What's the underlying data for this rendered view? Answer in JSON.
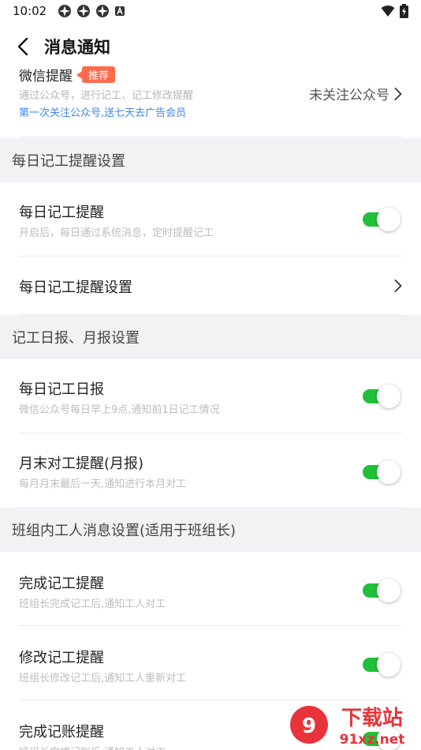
{
  "status_bar": {
    "time": "10:02"
  },
  "nav": {
    "title": "消息通知"
  },
  "wechat": {
    "title": "微信提醒",
    "tag": "推荐",
    "subtitle": "通过公众号，进行记工、记工修改提醒",
    "link": "第一次关注公众号,送七天去广告会员",
    "status": "未关注公众号"
  },
  "sections": [
    {
      "header": "每日记工提醒设置",
      "rows": [
        {
          "title": "每日记工提醒",
          "subtitle": "开启后，每日通过系统消息，定时提醒记工",
          "control": "toggle",
          "on": true
        },
        {
          "title": "每日记工提醒设置",
          "control": "chevron"
        }
      ]
    },
    {
      "header": "记工日报、月报设置",
      "rows": [
        {
          "title": "每日记工日报",
          "subtitle": "微信公众号每日早上9点,通知前1日记工情况",
          "control": "toggle",
          "on": true
        },
        {
          "title": "月末对工提醒(月报)",
          "subtitle": "每月月末最后一天,通知进行本月对工",
          "control": "toggle",
          "on": true
        }
      ]
    },
    {
      "header": "班组内工人消息设置(适用于班组长)",
      "rows": [
        {
          "title": "完成记工提醒",
          "subtitle": "班组长完成记工后,通知工人对工",
          "control": "toggle",
          "on": true
        },
        {
          "title": "修改记工提醒",
          "subtitle": "班组长修改记工后,通知工人重新对工",
          "control": "toggle",
          "on": true
        },
        {
          "title": "完成记账提醒",
          "subtitle": "班组长完成记账后,通知工人对工",
          "control": "toggle",
          "on": true
        }
      ]
    }
  ],
  "watermark": {
    "brand": "下载站",
    "domain": "91xz.net"
  },
  "colors": {
    "toggle_on": "#22c03a",
    "link": "#3f86f0",
    "tag": "#ff6a4d",
    "section_bg": "#f2f2f5"
  }
}
